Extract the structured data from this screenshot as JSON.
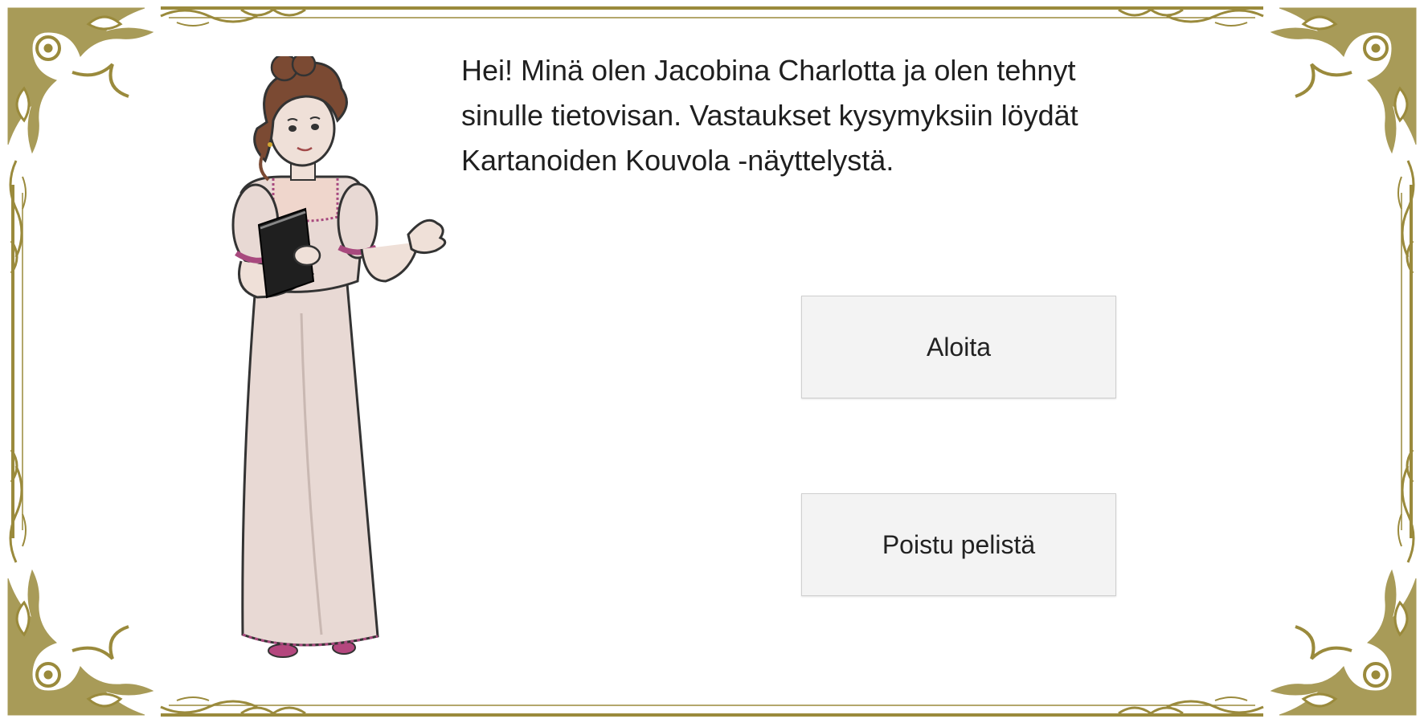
{
  "intro": {
    "lines": [
      "Hei! Minä olen Jacobina Charlotta ja olen tehnyt",
      "sinulle tietovisan. Vastaukset kysymyksiin löydät",
      "Kartanoiden Kouvola -näyttelystä."
    ]
  },
  "menu": {
    "start_label": "Aloita",
    "quit_label": "Poistu pelistä"
  },
  "colors": {
    "frame_gold": "#9a8a3c",
    "button_bg": "#f3f3f3",
    "dress": "#e8d9d4",
    "sash": "#a8497e"
  },
  "icons": {
    "frame": "ornate-gold-frame",
    "character": "regency-lady-with-book"
  }
}
